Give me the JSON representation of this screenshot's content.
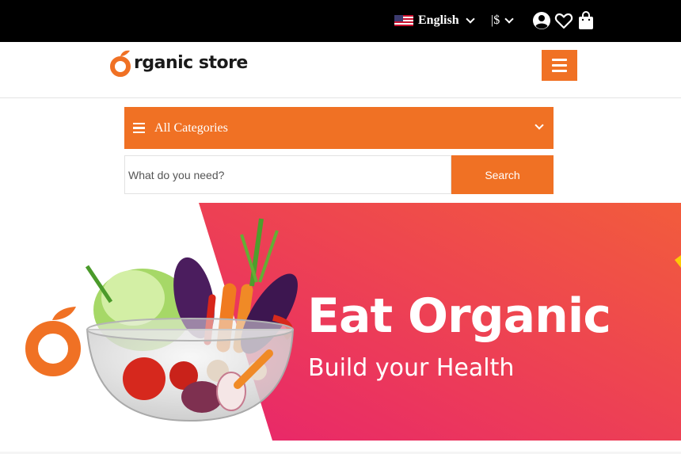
{
  "topbar": {
    "language": {
      "label": "English",
      "flag_icon": "us-flag-icon"
    },
    "currency": {
      "label": "|$"
    },
    "icons": [
      "user-account-icon",
      "heart-icon",
      "shopping-bag-icon"
    ]
  },
  "header": {
    "logo_text": "rganic store",
    "menu_icon": "hamburger-menu-icon"
  },
  "categories": {
    "label": "All Categories"
  },
  "search": {
    "placeholder": "What do you need?",
    "button_label": "Search"
  },
  "banner": {
    "title": "Eat Organic",
    "subtitle": "Build your Health"
  },
  "colors": {
    "accent": "#f07124",
    "banner_pink": "#e8256c",
    "banner_orange": "#f25c3c",
    "topbar": "#000000"
  }
}
